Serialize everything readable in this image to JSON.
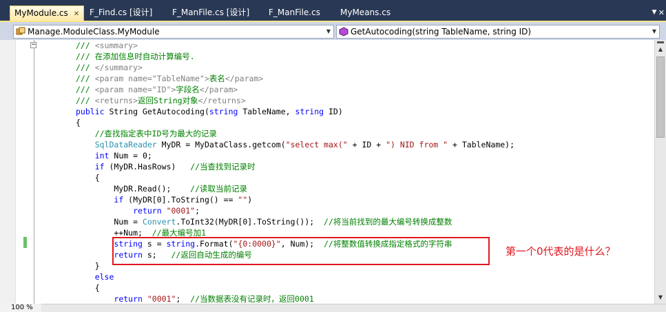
{
  "tabs": [
    {
      "label": "MyModule.cs",
      "active": true
    },
    {
      "label": "F_Find.cs [设计]",
      "active": false
    },
    {
      "label": "F_ManFile.cs [设计]",
      "active": false
    },
    {
      "label": "F_ManFile.cs",
      "active": false
    },
    {
      "label": "MyMeans.cs",
      "active": false
    }
  ],
  "navigation": {
    "class_combo": "Manage.ModuleClass.MyModule",
    "member_combo": "GetAutocoding(string TableName, string ID)"
  },
  "code_lines": [
    [
      {
        "t": "/// ",
        "c": "cm"
      },
      {
        "t": "<summary>",
        "c": "xd"
      }
    ],
    [
      {
        "t": "/// ",
        "c": "cm"
      },
      {
        "t": "在添加信息时自动计算编号.",
        "c": "cm"
      }
    ],
    [
      {
        "t": "/// ",
        "c": "cm"
      },
      {
        "t": "</summary>",
        "c": "xd"
      }
    ],
    [
      {
        "t": "/// ",
        "c": "cm"
      },
      {
        "t": "<param name=\"TableName\">",
        "c": "xd"
      },
      {
        "t": "表名",
        "c": "cm"
      },
      {
        "t": "</param>",
        "c": "xd"
      }
    ],
    [
      {
        "t": "/// ",
        "c": "cm"
      },
      {
        "t": "<param name=\"ID\">",
        "c": "xd"
      },
      {
        "t": "字段名",
        "c": "cm"
      },
      {
        "t": "</param>",
        "c": "xd"
      }
    ],
    [
      {
        "t": "/// ",
        "c": "cm"
      },
      {
        "t": "<returns>",
        "c": "xd"
      },
      {
        "t": "返回String对象",
        "c": "cm"
      },
      {
        "t": "</returns>",
        "c": "xd"
      }
    ],
    [
      {
        "t": "public",
        "c": "kw"
      },
      {
        "t": " String GetAutocoding(",
        "c": ""
      },
      {
        "t": "string",
        "c": "kw"
      },
      {
        "t": " TableName, ",
        "c": ""
      },
      {
        "t": "string",
        "c": "kw"
      },
      {
        "t": " ID)",
        "c": ""
      }
    ],
    [
      {
        "t": "{",
        "c": ""
      }
    ],
    [
      {
        "t": "    //查找指定表中ID号为最大的记录",
        "c": "cm"
      }
    ],
    [
      {
        "t": "    ",
        "c": ""
      },
      {
        "t": "SqlDataReader",
        "c": "ty"
      },
      {
        "t": " MyDR = MyDataClass.getcom(",
        "c": ""
      },
      {
        "t": "\"select max(\"",
        "c": "st"
      },
      {
        "t": " + ID + ",
        "c": ""
      },
      {
        "t": "\") NID from \"",
        "c": "st"
      },
      {
        "t": " + TableName);",
        "c": ""
      }
    ],
    [
      {
        "t": "    ",
        "c": ""
      },
      {
        "t": "int",
        "c": "kw"
      },
      {
        "t": " Num = 0;",
        "c": ""
      }
    ],
    [
      {
        "t": "    ",
        "c": ""
      },
      {
        "t": "if",
        "c": "kw"
      },
      {
        "t": " (MyDR.HasRows)   ",
        "c": ""
      },
      {
        "t": "//当查找到记录时",
        "c": "cm"
      }
    ],
    [
      {
        "t": "    {",
        "c": ""
      }
    ],
    [
      {
        "t": "        MyDR.Read();    ",
        "c": ""
      },
      {
        "t": "//读取当前记录",
        "c": "cm"
      }
    ],
    [
      {
        "t": "        ",
        "c": ""
      },
      {
        "t": "if",
        "c": "kw"
      },
      {
        "t": " (MyDR[0].ToString() == ",
        "c": ""
      },
      {
        "t": "\"\"",
        "c": "st"
      },
      {
        "t": ")",
        "c": ""
      }
    ],
    [
      {
        "t": "            ",
        "c": ""
      },
      {
        "t": "return",
        "c": "kw"
      },
      {
        "t": " ",
        "c": ""
      },
      {
        "t": "\"0001\"",
        "c": "st"
      },
      {
        "t": ";",
        "c": ""
      }
    ],
    [
      {
        "t": "        Num = ",
        "c": ""
      },
      {
        "t": "Convert",
        "c": "ty"
      },
      {
        "t": ".ToInt32(MyDR[0].ToString());  ",
        "c": ""
      },
      {
        "t": "//将当前找到的最大编号转换成整数",
        "c": "cm"
      }
    ],
    [
      {
        "t": "        ++Num;  ",
        "c": ""
      },
      {
        "t": "//最大编号加1",
        "c": "cm"
      }
    ],
    [
      {
        "t": "        ",
        "c": ""
      },
      {
        "t": "string",
        "c": "kw"
      },
      {
        "t": " s = ",
        "c": ""
      },
      {
        "t": "string",
        "c": "kw"
      },
      {
        "t": ".Format(",
        "c": ""
      },
      {
        "t": "\"{0:0000}\"",
        "c": "st"
      },
      {
        "t": ", Num);  ",
        "c": ""
      },
      {
        "t": "//将整数值转换成指定格式的字符串",
        "c": "cm"
      }
    ],
    [
      {
        "t": "        ",
        "c": ""
      },
      {
        "t": "return",
        "c": "kw"
      },
      {
        "t": " s;   ",
        "c": ""
      },
      {
        "t": "//返回自动生成的编号",
        "c": "cm"
      }
    ],
    [
      {
        "t": "    }",
        "c": ""
      }
    ],
    [
      {
        "t": "    ",
        "c": ""
      },
      {
        "t": "else",
        "c": "kw"
      }
    ],
    [
      {
        "t": "    {",
        "c": ""
      }
    ],
    [
      {
        "t": "        ",
        "c": ""
      },
      {
        "t": "return",
        "c": "kw"
      },
      {
        "t": " ",
        "c": ""
      },
      {
        "t": "\"0001\"",
        "c": "st"
      },
      {
        "t": ";  ",
        "c": ""
      },
      {
        "t": "//当数据表没有记录时，返回0001",
        "c": "cm"
      }
    ]
  ],
  "annotation": "第一个0代表的是什么？",
  "zoom_level": "100 %",
  "colors": {
    "keyword": "#0000ff",
    "comment": "#008000",
    "xmldoc": "#808080",
    "type": "#2b91af",
    "string": "#a31515",
    "annotation": "#e0171f"
  },
  "icons": {
    "class_combo_icon": "class-icon",
    "member_combo_icon": "method-icon"
  }
}
